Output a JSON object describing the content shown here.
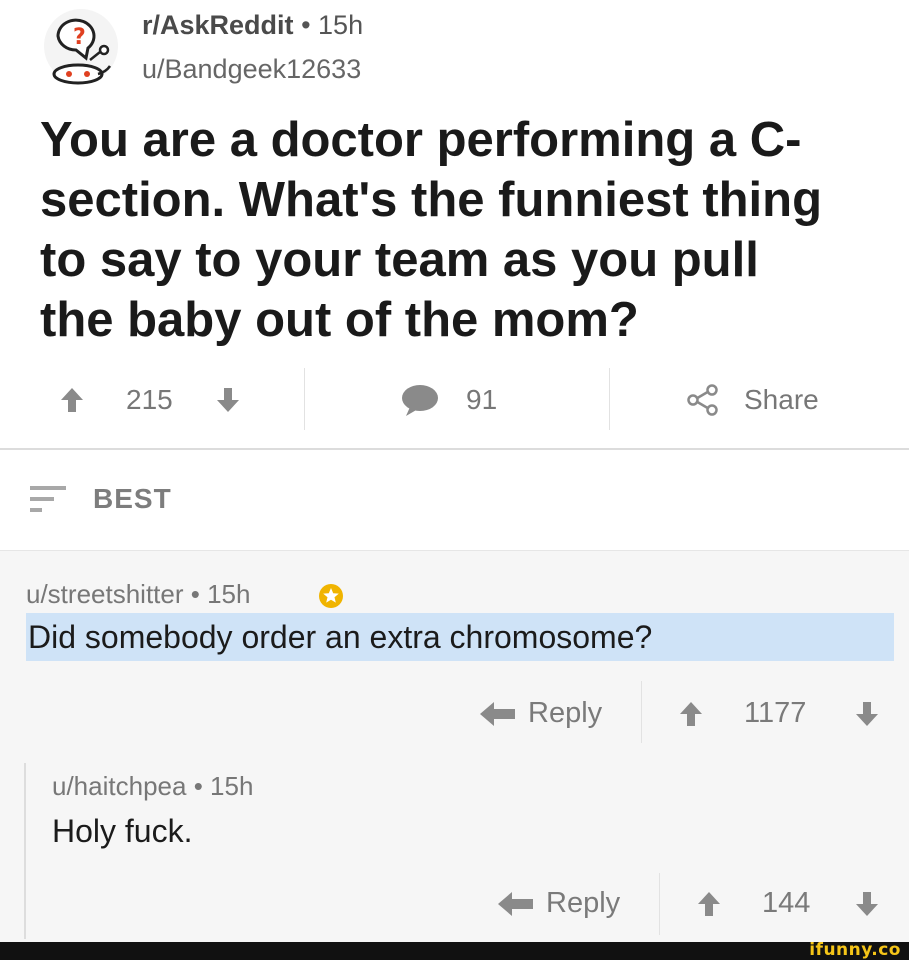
{
  "post": {
    "subreddit": "r/AskReddit",
    "separator": "•",
    "age": "15h",
    "author": "u/Bandgeek12633",
    "title": "You are a doctor performing a C-section. What's the funniest thing to say to your team as you pull the baby out of the mom?",
    "score": "215",
    "comment_count": "91",
    "share_label": "Share",
    "icon": "askreddit-snoo-icon"
  },
  "sort": {
    "label": "BEST",
    "icon": "sort-icon"
  },
  "comments": [
    {
      "author": "u/streetshitter",
      "separator": "•",
      "age": "15h",
      "badge_icon": "gold-award-icon",
      "body": "Did somebody order an extra chromosome?",
      "reply_label": "Reply",
      "score": "1177"
    },
    {
      "author": "u/haitchpea",
      "separator": "•",
      "age": "15h",
      "body": "Holy fuck.",
      "reply_label": "Reply",
      "score": "144"
    }
  ],
  "watermark": "ifunny.co",
  "colors": {
    "highlight": "#cfe3f7",
    "award": "#f0b400",
    "icon_gray": "#8a8a8a",
    "subreddit_red": "#ff4500"
  }
}
